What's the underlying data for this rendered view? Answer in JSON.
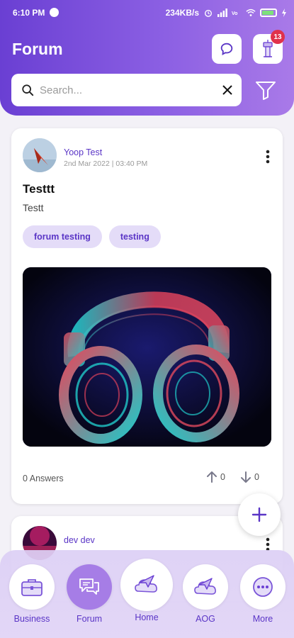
{
  "status_bar": {
    "time": "6:10 PM",
    "network_speed": "234KB/s",
    "battery_level": "95"
  },
  "header": {
    "title": "Forum",
    "notification_count": "13"
  },
  "search": {
    "placeholder": "Search...",
    "value": ""
  },
  "posts": [
    {
      "author": "Yoop Test",
      "date": "2nd Mar 2022 | 03:40 PM",
      "title": "Testtt",
      "body": "Testt",
      "tags": [
        "forum testing",
        "testing"
      ],
      "answers": "0 Answers",
      "upvotes": "0",
      "downvotes": "0"
    },
    {
      "author": "dev dev"
    }
  ],
  "nav": {
    "items": [
      {
        "label": "Business"
      },
      {
        "label": "Forum"
      },
      {
        "label": "Home"
      },
      {
        "label": "AOG"
      },
      {
        "label": "More"
      }
    ]
  },
  "colors": {
    "accent": "#5a35c6",
    "header_start": "#6a3fd3",
    "header_end": "#a97ae8",
    "tag_bg": "#e4dcf8",
    "nav_active": "#a67de6",
    "badge": "#e0324b"
  }
}
